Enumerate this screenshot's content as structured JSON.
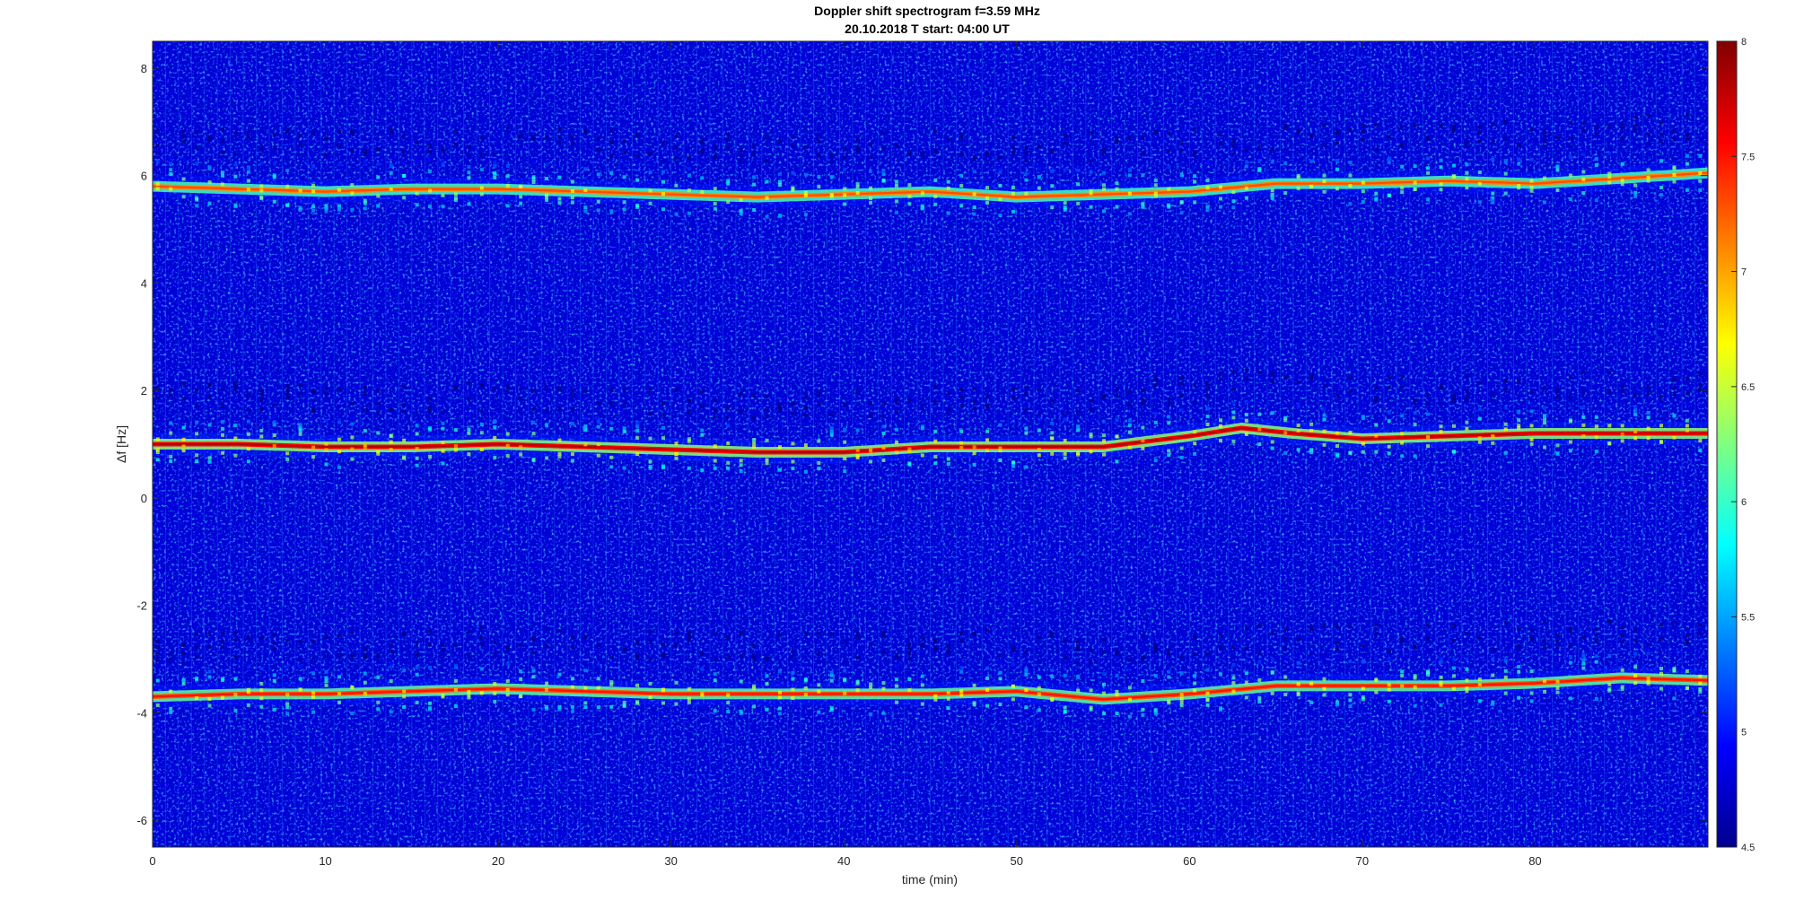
{
  "chart_data": {
    "type": "heatmap",
    "title": "Doppler shift spectrogram f=3.59 MHz",
    "subtitle": "20.10.2018   T start: 04:00 UT",
    "xlabel": "time (min)",
    "ylabel": "Δf [Hz]",
    "xlim": [
      0,
      90
    ],
    "ylim": [
      -6.5,
      8.5
    ],
    "x_ticks": [
      "0",
      "10",
      "20",
      "30",
      "40",
      "50",
      "60",
      "70",
      "80"
    ],
    "y_ticks": [
      "-6",
      "-4",
      "-2",
      "0",
      "2",
      "4",
      "6",
      "8"
    ],
    "colorbar": {
      "colormap": "jet",
      "range": [
        4.5,
        8
      ],
      "ticks": [
        "4.5",
        "5",
        "5.5",
        "6",
        "6.5",
        "7",
        "7.5",
        "8"
      ]
    },
    "background_level": 4.8,
    "traces": [
      {
        "time_min": [
          0,
          5,
          10,
          15,
          20,
          25,
          30,
          35,
          40,
          45,
          50,
          55,
          60,
          65,
          70,
          75,
          80,
          85,
          90
        ],
        "doppler_hz": [
          5.8,
          5.75,
          5.7,
          5.75,
          5.75,
          5.7,
          5.65,
          5.6,
          5.65,
          5.7,
          5.6,
          5.65,
          5.7,
          5.85,
          5.85,
          5.9,
          5.85,
          5.95,
          6.05
        ],
        "peak_level": 7.3
      },
      {
        "time_min": [
          0,
          5,
          10,
          15,
          20,
          25,
          30,
          35,
          40,
          45,
          50,
          55,
          60,
          63,
          66,
          70,
          75,
          80,
          85,
          90
        ],
        "doppler_hz": [
          1.0,
          1.0,
          0.95,
          0.95,
          1.0,
          0.95,
          0.9,
          0.85,
          0.85,
          0.95,
          0.95,
          0.95,
          1.15,
          1.3,
          1.2,
          1.1,
          1.15,
          1.2,
          1.2,
          1.2
        ],
        "peak_level": 7.8
      },
      {
        "time_min": [
          0,
          5,
          10,
          15,
          20,
          25,
          30,
          35,
          40,
          45,
          50,
          55,
          60,
          65,
          70,
          75,
          80,
          85,
          90
        ],
        "doppler_hz": [
          -3.7,
          -3.65,
          -3.65,
          -3.6,
          -3.55,
          -3.6,
          -3.65,
          -3.65,
          -3.65,
          -3.65,
          -3.6,
          -3.75,
          -3.65,
          -3.5,
          -3.5,
          -3.5,
          -3.45,
          -3.35,
          -3.4
        ],
        "peak_level": 7.5
      }
    ]
  }
}
